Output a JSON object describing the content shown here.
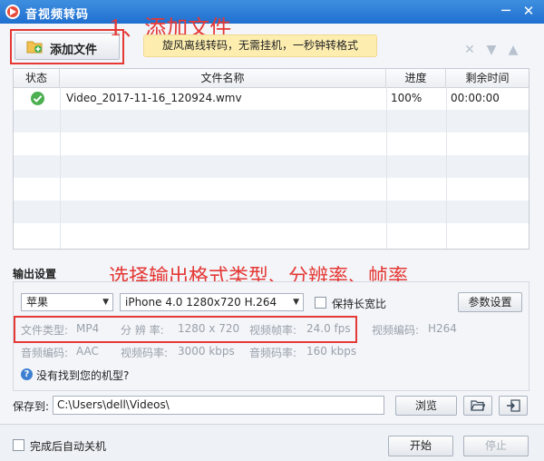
{
  "window": {
    "title": "音视频转码",
    "minimize_glyph": "─",
    "close_glyph": "✕"
  },
  "toolbar": {
    "add_file_label": "添加文件",
    "tip": "旋风离线转码，无需挂机，一秒钟转格式",
    "icons": [
      "delete-icon",
      "move-down-icon",
      "move-up-icon"
    ]
  },
  "annotations": {
    "step1": "1、添加文件",
    "step2": "选择输出格式类型、分辨率、帧率"
  },
  "table": {
    "columns": [
      "状态",
      "文件名称",
      "进度",
      "剩余时间"
    ],
    "rows": [
      {
        "status": "done",
        "name": "Video_2017-11-16_120924.wmv",
        "progress": "100%",
        "remaining": "00:00:00"
      }
    ]
  },
  "output": {
    "section_title": "输出设置",
    "device_brand": "苹果",
    "device_model": "iPhone 4.0 1280x720 H.264",
    "keep_ratio_label": "保持长宽比",
    "params_button": "参数设置",
    "specs": {
      "file_type_label": "文件类型:",
      "file_type": "MP4",
      "resolution_label": "分 辨 率:",
      "resolution": "1280 x 720",
      "frame_rate_label": "视频帧率:",
      "frame_rate": "24.0 fps",
      "video_codec_label": "视频编码:",
      "video_codec": "H264",
      "audio_codec_label": "音频编码:",
      "audio_codec": "AAC",
      "video_bitrate_label": "视频码率:",
      "video_bitrate": "3000 kbps",
      "audio_bitrate_label": "音频码率:",
      "audio_bitrate": "160 kbps"
    },
    "help_text": "没有找到您的机型?"
  },
  "save": {
    "label": "保存到:",
    "path": "C:\\Users\\dell\\Videos\\",
    "browse_button": "浏览"
  },
  "footer": {
    "auto_shutdown_label": "完成后自动关机",
    "start_button": "开始",
    "stop_button": "停止"
  },
  "colors": {
    "accent": "#1f6fd0",
    "annotation": "#e53935",
    "tip_bg": "#fdeeb0",
    "done_green": "#4caf50"
  }
}
